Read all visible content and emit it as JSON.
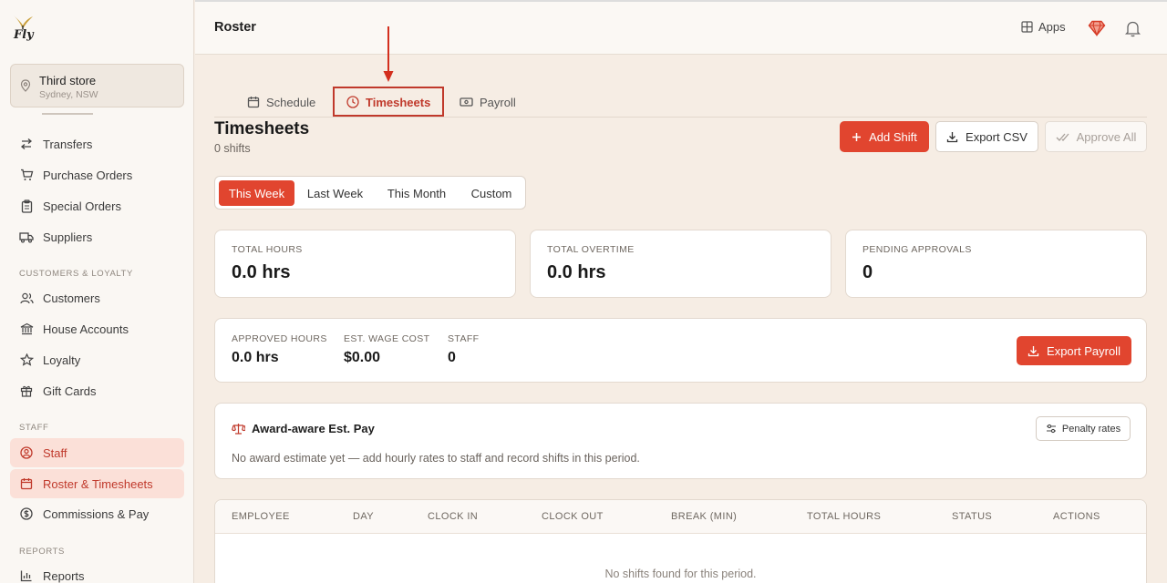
{
  "brand": {
    "logo_text": "Fly"
  },
  "store": {
    "name": "Third store",
    "location": "Sydney, NSW"
  },
  "sidebar": {
    "items": [
      {
        "label": "Transfers"
      },
      {
        "label": "Purchase Orders"
      },
      {
        "label": "Special Orders"
      },
      {
        "label": "Suppliers"
      },
      {
        "label": "Customers"
      },
      {
        "label": "House Accounts"
      },
      {
        "label": "Loyalty"
      },
      {
        "label": "Gift Cards"
      },
      {
        "label": "Staff"
      },
      {
        "label": "Roster & Timesheets"
      },
      {
        "label": "Commissions & Pay"
      },
      {
        "label": "Reports"
      }
    ],
    "sections": {
      "customers": "CUSTOMERS & LOYALTY",
      "staff": "STAFF",
      "reports": "REPORTS"
    }
  },
  "header": {
    "title": "Roster",
    "apps_label": "Apps"
  },
  "tabs": [
    {
      "label": "Schedule"
    },
    {
      "label": "Timesheets"
    },
    {
      "label": "Payroll"
    }
  ],
  "page": {
    "title": "Timesheets",
    "subtitle": "0 shifts"
  },
  "actions": {
    "add_shift": "Add Shift",
    "export_csv": "Export CSV",
    "approve_all": "Approve All"
  },
  "ranges": [
    "This Week",
    "Last Week",
    "This Month",
    "Custom"
  ],
  "stats": [
    {
      "label": "TOTAL HOURS",
      "value": "0.0 hrs"
    },
    {
      "label": "TOTAL OVERTIME",
      "value": "0.0 hrs"
    },
    {
      "label": "PENDING APPROVALS",
      "value": "0"
    }
  ],
  "summary": [
    {
      "label": "APPROVED HOURS",
      "value": "0.0 hrs"
    },
    {
      "label": "EST. WAGE COST",
      "value": "$0.00"
    },
    {
      "label": "STAFF",
      "value": "0"
    }
  ],
  "export_payroll": "Export Payroll",
  "award": {
    "title": "Award-aware Est. Pay",
    "message": "No award estimate yet — add hourly rates to staff and record shifts in this period.",
    "penalty_button": "Penalty rates"
  },
  "table": {
    "columns": [
      "EMPLOYEE",
      "DAY",
      "CLOCK IN",
      "CLOCK OUT",
      "BREAK (MIN)",
      "TOTAL HOURS",
      "STATUS",
      "ACTIONS"
    ],
    "empty_message": "No shifts found for this period."
  },
  "colors": {
    "accent": "#e1452f",
    "active_text": "#c0392b",
    "active_bg": "#fbe0d8",
    "background": "#f6ede4"
  }
}
